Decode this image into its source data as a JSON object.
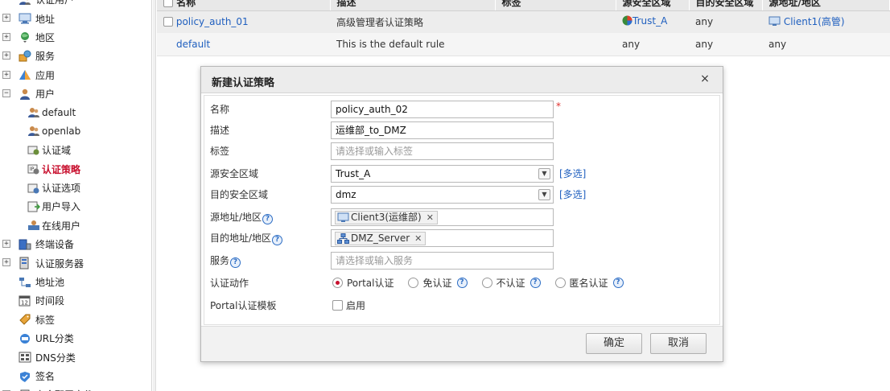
{
  "sidebar": {
    "items": [
      {
        "label": "认证用户",
        "icon": "user-group-icon",
        "level": 0,
        "expand": "",
        "partial": true
      },
      {
        "label": "地址",
        "icon": "monitor-icon",
        "level": 0,
        "expand": "+"
      },
      {
        "label": "地区",
        "icon": "globe-pin-icon",
        "level": 0,
        "expand": "+"
      },
      {
        "label": "服务",
        "icon": "service-icon",
        "level": 0,
        "expand": "+"
      },
      {
        "label": "应用",
        "icon": "app-icon",
        "level": 0,
        "expand": "+"
      },
      {
        "label": "用户",
        "icon": "user-icon",
        "level": 0,
        "expand": "−"
      },
      {
        "label": "default",
        "icon": "user-group-icon",
        "level": 1
      },
      {
        "label": "openlab",
        "icon": "user-group-icon",
        "level": 1
      },
      {
        "label": "认证域",
        "icon": "auth-domain-icon",
        "level": 1
      },
      {
        "label": "认证策略",
        "icon": "auth-policy-icon",
        "level": 1,
        "active": true
      },
      {
        "label": "认证选项",
        "icon": "auth-option-icon",
        "level": 1
      },
      {
        "label": "用户导入",
        "icon": "user-import-icon",
        "level": 1
      },
      {
        "label": "在线用户",
        "icon": "online-user-icon",
        "level": 1
      },
      {
        "label": "终端设备",
        "icon": "terminal-icon",
        "level": 0,
        "expand": "+"
      },
      {
        "label": "认证服务器",
        "icon": "server-icon",
        "level": 0,
        "expand": "+"
      },
      {
        "label": "地址池",
        "icon": "address-pool-icon",
        "level": 0
      },
      {
        "label": "时间段",
        "icon": "calendar-icon",
        "level": 0
      },
      {
        "label": "标签",
        "icon": "tag-icon",
        "level": 0
      },
      {
        "label": "URL分类",
        "icon": "url-category-icon",
        "level": 0
      },
      {
        "label": "DNS分类",
        "icon": "dns-category-icon",
        "level": 0
      },
      {
        "label": "签名",
        "icon": "signature-icon",
        "level": 0
      },
      {
        "label": "安全配置文件",
        "icon": "security-profile-icon",
        "level": 0,
        "expand": "+"
      }
    ]
  },
  "table": {
    "columns": [
      "名称",
      "描述",
      "标签",
      "源安全区域",
      "目的安全区域",
      "源地址/地区"
    ],
    "rows": [
      {
        "name": "policy_auth_01",
        "desc": "高级管理者认证策略",
        "tag": "",
        "src_zone": "Trust_A",
        "dst_zone": "any",
        "src_addr": "Client1(高管)"
      },
      {
        "name": "default",
        "desc": "This is the default rule",
        "tag": "",
        "src_zone": "any",
        "dst_zone": "any",
        "src_addr": "any"
      }
    ]
  },
  "dialog": {
    "title": "新建认证策略",
    "close": "×",
    "fields": {
      "name": {
        "label": "名称",
        "value": "policy_auth_02",
        "required": "*"
      },
      "desc": {
        "label": "描述",
        "value": "运维部_to_DMZ"
      },
      "tag": {
        "label": "标签",
        "placeholder": "请选择或输入标签"
      },
      "src_zone": {
        "label": "源安全区域",
        "value": "Trust_A",
        "multi": "[多选]"
      },
      "dst_zone": {
        "label": "目的安全区域",
        "value": "dmz",
        "multi": "[多选]"
      },
      "src_addr": {
        "label": "源地址/地区",
        "tag": "Client3(运维部)"
      },
      "dst_addr": {
        "label": "目的地址/地区",
        "tag": "DMZ_Server"
      },
      "service": {
        "label": "服务",
        "placeholder": "请选择或输入服务"
      },
      "auth_action": {
        "label": "认证动作",
        "options": [
          "Portal认证",
          "免认证",
          "不认证",
          "匿名认证"
        ],
        "selected": "Portal认证"
      },
      "portal_template": {
        "label": "Portal认证模板",
        "checkbox_label": "启用"
      }
    },
    "buttons": {
      "ok": "确定",
      "cancel": "取消"
    }
  },
  "colors": {
    "accent": "#c8102e",
    "link": "#1f5fbf"
  }
}
